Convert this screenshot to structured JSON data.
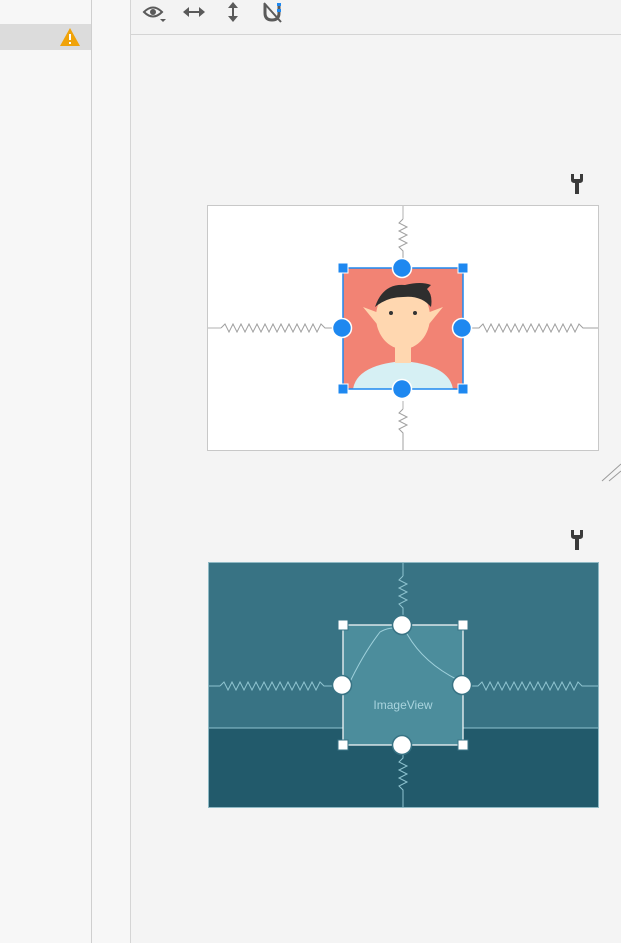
{
  "component_tree": {
    "warning_icon": "warning-icon",
    "selected_row_label": ""
  },
  "toolbar": {
    "icons": [
      "eye-icon",
      "horizontal-expand-icon",
      "vertical-expand-icon",
      "magnet-off-icon"
    ]
  },
  "design_view": {
    "widget": "person-placeholder-image"
  },
  "blueprint_view": {
    "widget_label": "ImageView"
  },
  "colors": {
    "accent": "#1e88f0",
    "image_bg": "#f28374",
    "blueprint_bg": "#387384",
    "blueprint_dark": "#225a6b",
    "warning": "#f0a30a"
  }
}
